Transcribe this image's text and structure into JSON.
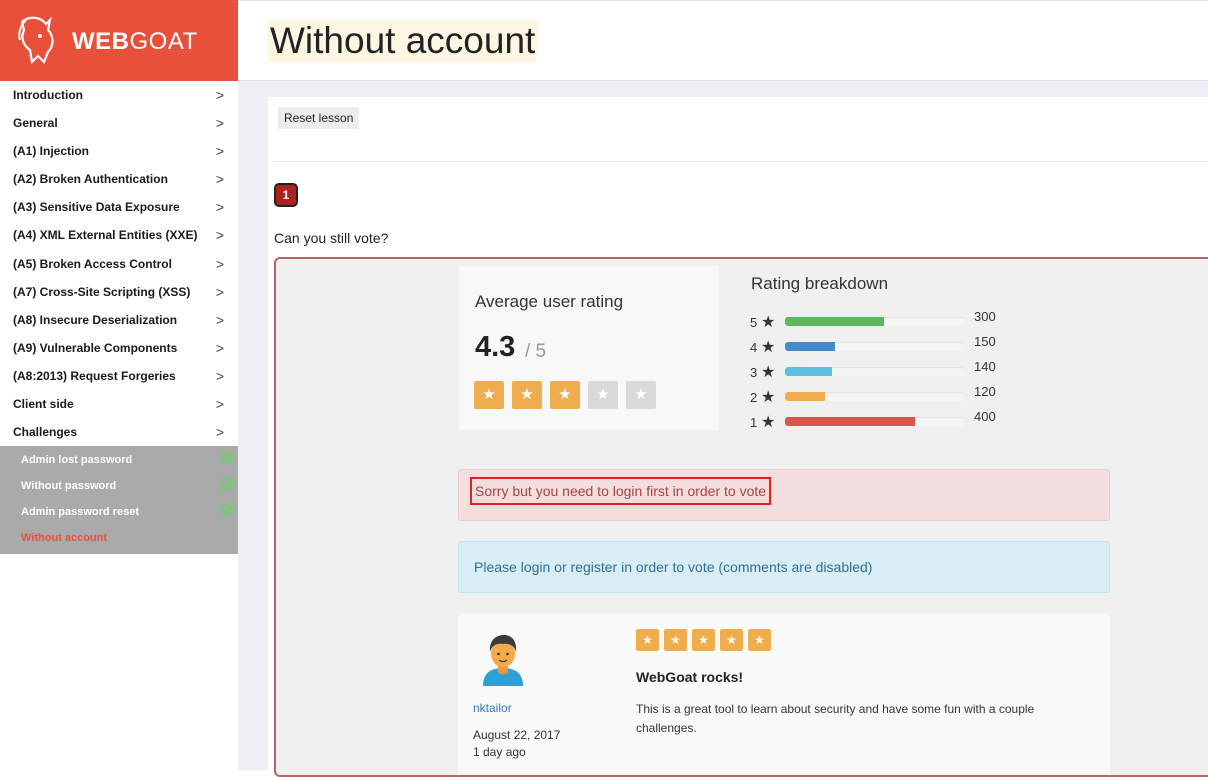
{
  "brand": {
    "web": "WEB",
    "goat": "GOAT"
  },
  "sidebar": {
    "items": [
      {
        "label": "Introduction",
        "chevron": ">"
      },
      {
        "label": "General",
        "chevron": ">"
      },
      {
        "label": "(A1) Injection",
        "chevron": ">"
      },
      {
        "label": "(A2) Broken Authentication",
        "chevron": ">"
      },
      {
        "label": "(A3) Sensitive Data Exposure",
        "chevron": ">"
      },
      {
        "label": "(A4) XML External Entities (XXE)",
        "chevron": ">"
      },
      {
        "label": "(A5) Broken Access Control",
        "chevron": ">"
      },
      {
        "label": "(A7) Cross-Site Scripting (XSS)",
        "chevron": ">"
      },
      {
        "label": "(A8) Insecure Deserialization",
        "chevron": ">"
      },
      {
        "label": "(A9) Vulnerable Components",
        "chevron": ">"
      },
      {
        "label": "(A8:2013) Request Forgeries",
        "chevron": ">"
      },
      {
        "label": "Client side",
        "chevron": ">"
      },
      {
        "label": "Challenges",
        "chevron": ">"
      }
    ],
    "subitems": [
      {
        "label": "Admin lost password",
        "completed": true
      },
      {
        "label": "Without password",
        "completed": true
      },
      {
        "label": "Admin password reset",
        "completed": true
      },
      {
        "label": "Without account",
        "completed": false,
        "active": true
      }
    ]
  },
  "header": {
    "title": "Without account"
  },
  "lesson": {
    "reset_label": "Reset lesson",
    "page_number": "1",
    "question": "Can you still vote?"
  },
  "rating": {
    "label": "Average user rating",
    "value": "4.3",
    "out_of": "/ 5",
    "stars_filled": 3,
    "stars_total": 5,
    "star_glyph": "★",
    "star_color": "#f0ad4e",
    "star_empty_color": "#d9d9d9"
  },
  "breakdown": {
    "title": "Rating breakdown",
    "rows": [
      {
        "stars": "5",
        "count": "300",
        "fill": 0.55,
        "color": "#5cb85c"
      },
      {
        "stars": "4",
        "count": "150",
        "fill": 0.28,
        "color": "#428bca"
      },
      {
        "stars": "3",
        "count": "140",
        "fill": 0.26,
        "color": "#5bc0de"
      },
      {
        "stars": "2",
        "count": "120",
        "fill": 0.22,
        "color": "#f0ad4e"
      },
      {
        "stars": "1",
        "count": "400",
        "fill": 0.72,
        "color": "#d9534f"
      }
    ]
  },
  "alerts": {
    "error": "Sorry but you need to login first in order to vote",
    "info_prefix": "Please ",
    "info_login": "login",
    "info_or": " or ",
    "info_register": "register",
    "info_suffix": " in order to vote (comments are disabled)"
  },
  "comment": {
    "user": "nktailor",
    "date": "August 22, 2017",
    "ago": "1 day ago",
    "stars": 5,
    "title": "WebGoat rocks!",
    "body": "This is a great tool to learn about security and have some fun with a couple challenges."
  },
  "colors": {
    "brand": "#e8503a",
    "check": "#5cdb5c"
  }
}
